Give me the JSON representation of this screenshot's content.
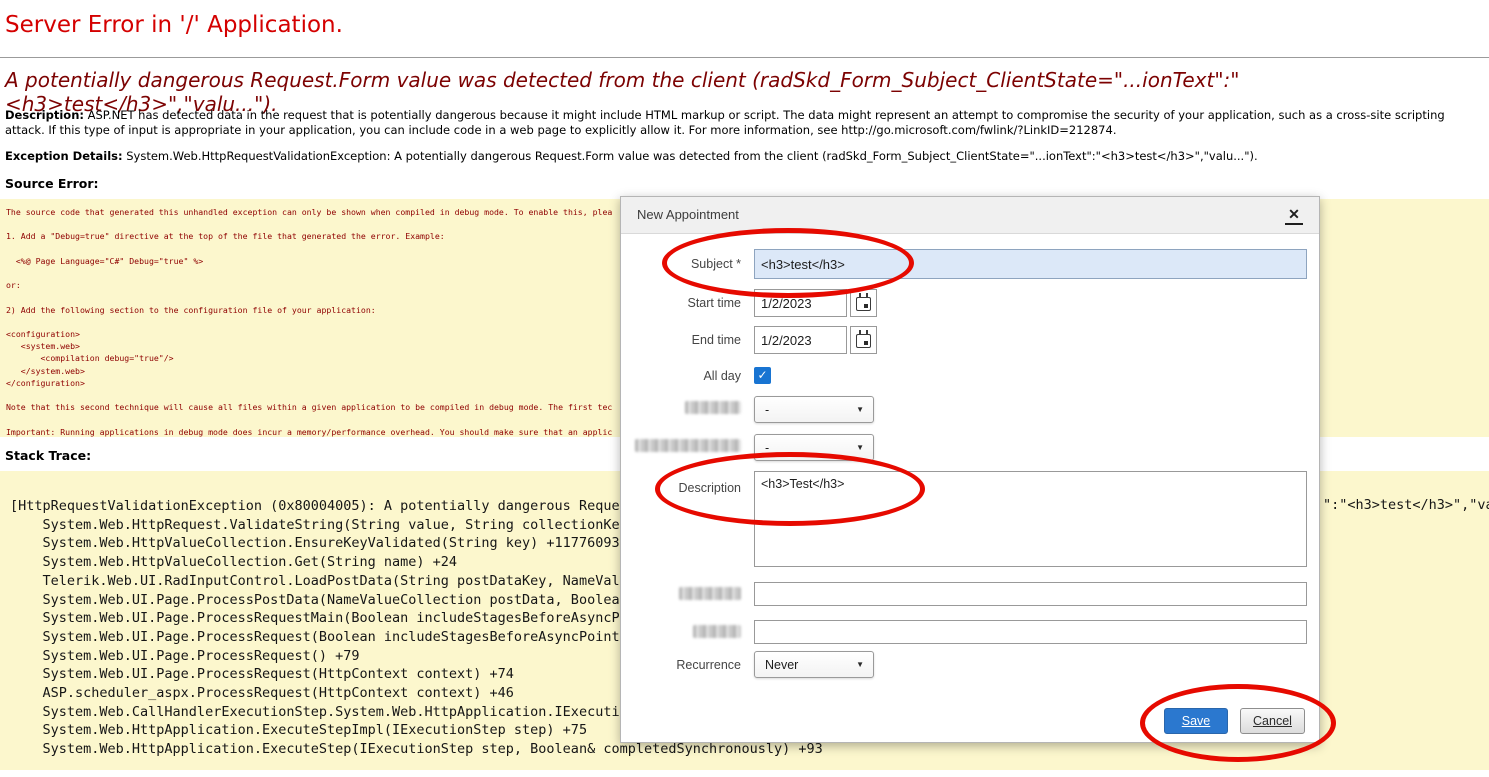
{
  "error_page": {
    "title": "Server Error in '/' Application.",
    "subtitle": "A potentially dangerous Request.Form value was detected from the client (radSkd_Form_Subject_ClientState=\"...ionText\":\"<h3>test</h3>\",\"valu...\").",
    "description_label": "Description:",
    "description_text": " ASP.NET has detected data in the request that is potentially dangerous because it might include HTML markup or script. The data might represent an attempt to compromise the security of your application, such as a cross-site scripting attack. If this type of input is appropriate in your application, you can include code in a web page to explicitly allow it. For more information, see http://go.microsoft.com/fwlink/?LinkID=212874.",
    "exception_label": "Exception Details:",
    "exception_text": " System.Web.HttpRequestValidationException: A potentially dangerous Request.Form value was detected from the client (radSkd_Form_Subject_ClientState=\"...ionText\":\"<h3>test</h3>\",\"valu...\").",
    "source_error_label": "Source Error:",
    "source_error_code": "The source code that generated this unhandled exception can only be shown when compiled in debug mode. To enable this, plea\n\n1. Add a \"Debug=true\" directive at the top of the file that generated the error. Example:\n\n  <%@ Page Language=\"C#\" Debug=\"true\" %>\n\nor:\n\n2) Add the following section to the configuration file of your application:\n\n<configuration>\n   <system.web>\n       <compilation debug=\"true\"/>\n   </system.web>\n</configuration>\n\nNote that this second technique will cause all files within a given application to be compiled in debug mode. The first tec\n\nImportant: Running applications in debug mode does incur a memory/performance overhead. You should make sure that an applic",
    "stack_trace_label": "Stack Trace:",
    "stack_trace_code": "[HttpRequestValidationException (0x80004005): A potentially dangerous Reque\n    System.Web.HttpRequest.ValidateString(String value, String collectionKey\n    System.Web.HttpValueCollection.EnsureKeyValidated(String key) +11776093\n    System.Web.HttpValueCollection.Get(String name) +24\n    Telerik.Web.UI.RadInputControl.LoadPostData(String postDataKey, NameValu\n    System.Web.UI.Page.ProcessPostData(NameValueCollection postData, Boolean\n    System.Web.UI.Page.ProcessRequestMain(Boolean includeStagesBeforeAsyncPo\n    System.Web.UI.Page.ProcessRequest(Boolean includeStagesBeforeAsyncPoint,\n    System.Web.UI.Page.ProcessRequest() +79\n    System.Web.UI.Page.ProcessRequest(HttpContext context) +74\n    ASP.scheduler_aspx.ProcessRequest(HttpContext context) +46\n    System.Web.CallHandlerExecutionStep.System.Web.HttpApplication.IExecutio\n    System.Web.HttpApplication.ExecuteStepImpl(IExecutionStep step) +75\n    System.Web.HttpApplication.ExecuteStep(IExecutionStep step, Boolean& completedSynchronously) +93",
    "stack_trace_right_fragment": "\":\"<h3>test</h3>\",\"va"
  },
  "modal": {
    "title": "New Appointment",
    "fields": {
      "subject": {
        "label": "Subject *",
        "value": "<h3>test</h3>"
      },
      "start_time": {
        "label": "Start time",
        "value": "1/2/2023"
      },
      "end_time": {
        "label": "End time",
        "value": "1/2/2023"
      },
      "all_day": {
        "label": "All day",
        "checked": true
      },
      "redacted_select_1": {
        "redacted": true,
        "value": "-"
      },
      "redacted_select_2": {
        "redacted": true,
        "value": "-"
      },
      "description": {
        "label": "Description",
        "value": "<h3>Test</h3>"
      },
      "redacted_input_1": {
        "redacted": true,
        "value": ""
      },
      "redacted_input_2": {
        "redacted": true,
        "value": ""
      },
      "recurrence": {
        "label": "Recurrence",
        "value": "Never"
      }
    },
    "buttons": {
      "save": "Save",
      "cancel": "Cancel"
    }
  },
  "icons": {
    "close": "✕",
    "checkmark": "✓",
    "dropdown_arrow": "▼"
  },
  "annotations": {
    "color": "#e60a00",
    "items": [
      "subject-field",
      "description-field",
      "save-cancel-buttons"
    ]
  },
  "colors": {
    "title_red": "#d40000",
    "subtitle_maroon": "#7c0202",
    "box_yellow": "#fcf7cd",
    "source_code_maroon": "#8f0000",
    "save_button_blue": "#2b78cf",
    "subject_input_blue": "#dce8f8",
    "checkbox_blue": "#1874d2"
  }
}
